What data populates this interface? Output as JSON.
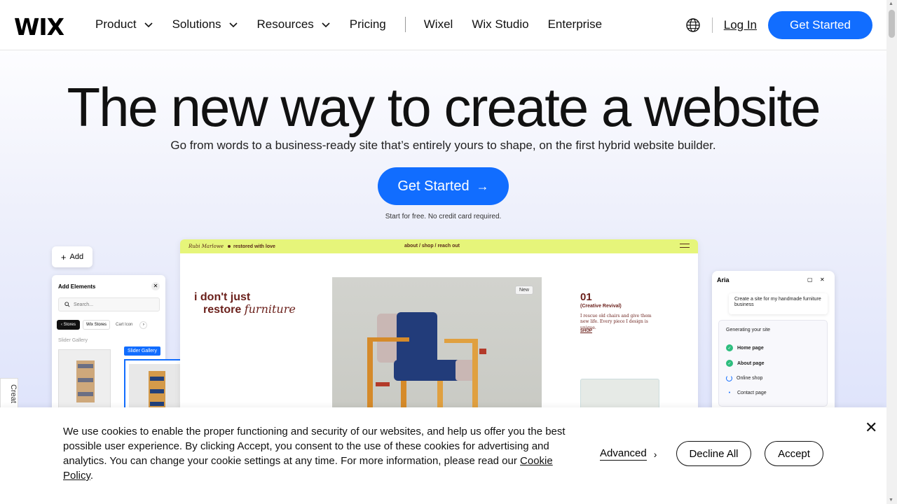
{
  "header": {
    "logo": "WIX",
    "nav": [
      {
        "label": "Product",
        "dropdown": true
      },
      {
        "label": "Solutions",
        "dropdown": true
      },
      {
        "label": "Resources",
        "dropdown": true
      },
      {
        "label": "Pricing",
        "dropdown": false
      }
    ],
    "nav2": [
      "Wixel",
      "Wix Studio",
      "Enterprise"
    ],
    "login": "Log In",
    "cta": "Get Started"
  },
  "hero": {
    "title": "The new way to create a website",
    "subtitle": "Go from words to a business-ready site that’s entirely yours to shape, on the first hybrid website builder.",
    "cta": "Get Started",
    "note": "Start for free. No credit card required."
  },
  "editor": {
    "add_label": "Add",
    "panel_title": "Add Elements",
    "search_placeholder": "Search...",
    "tab_stores": "Stores",
    "tab_wix_stores": "Wix Stores",
    "tab_cart": "Cart Icon",
    "slider_gallery": "Slider Gallery",
    "slider_badge": "Slider Gallery"
  },
  "site": {
    "brand": "Rubi Marlowe",
    "brand_tag": "restored with love",
    "links": "about  /  shop  /  reach out",
    "tagline1": "i don't just",
    "tagline2_a": "restore",
    "tagline2_b": "furniture",
    "new_badge": "New",
    "num": "01",
    "creative": "(Creative Revival)",
    "desc": "I rescue old chairs and give them new life. Every piece I design is unique.",
    "shop": "SHOP"
  },
  "aria": {
    "name": "Aria",
    "prompt": "Create a site for my handmade furniture business",
    "generating": "Generating your site",
    "steps": [
      {
        "label": "Home page",
        "status": "done"
      },
      {
        "label": "About page",
        "status": "done"
      },
      {
        "label": "Online shop",
        "status": "loading"
      },
      {
        "label": "Contact page",
        "status": "pending"
      }
    ]
  },
  "side_tab": "Creat",
  "cookie": {
    "text": "We use cookies to enable the proper functioning and security of our websites, and help us offer you the best possible user experience. By clicking Accept, you consent to the use of these cookies for advertising and analytics. You can change your cookie settings at any time. For more information, please read our ",
    "link": "Cookie Policy",
    "period": ".",
    "advanced": "Advanced",
    "decline": "Decline All",
    "accept": "Accept"
  },
  "colors": {
    "accent": "#116dff",
    "site_bar": "#e6f57a",
    "brand_text": "#6a1f1a",
    "check": "#2dbd7e"
  }
}
